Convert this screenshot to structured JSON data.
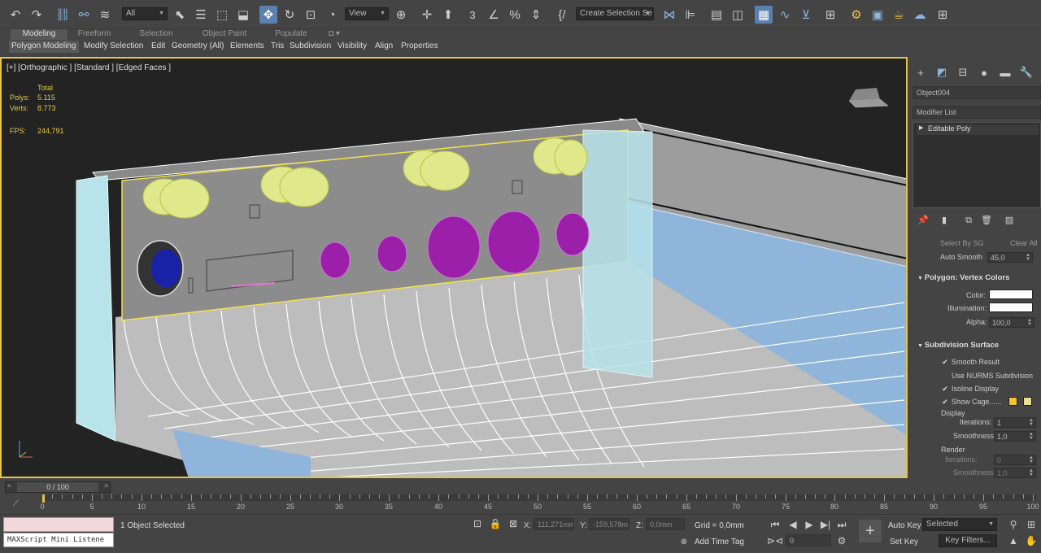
{
  "toolbar": {
    "filter_value": "All",
    "ref_coord_value": "View",
    "named_selection_placeholder": "Create Selection Se",
    "icons": [
      "undo-icon",
      "redo-icon",
      "link-icon",
      "unlink-icon",
      "bind-space-warp-icon",
      "select-object-icon",
      "select-by-name-icon",
      "rect-region-icon",
      "window-crossing-icon",
      "select-move-icon",
      "select-rotate-icon",
      "select-scale-icon",
      "select-place-icon",
      "pivot-icon",
      "keyboard-shortcut-icon",
      "snaps-3d-icon",
      "angle-snap-icon",
      "percent-snap-icon",
      "spinner-snap-icon",
      "edit-named-sel-icon",
      "mirror-icon",
      "align-icon",
      "scene-explorer-icon",
      "layer-explorer-icon",
      "ribbon-icon",
      "curve-editor-icon",
      "schematic-view-icon",
      "material-editor-icon",
      "render-setup-icon",
      "rendered-frame-icon",
      "render-icon",
      "render-cloud-icon",
      "a360-icon",
      "grid-icon"
    ]
  },
  "ribbon": {
    "tabs": [
      "Modeling",
      "Freeform",
      "Selection",
      "Object Paint",
      "Populate"
    ],
    "buttons": [
      "Polygon Modeling",
      "Modify Selection",
      "Edit",
      "Geometry (All)",
      "Elements",
      "Tris",
      "Subdivision",
      "Visibility",
      "Align",
      "Properties"
    ]
  },
  "viewport": {
    "label": "[+] [Orthographic ] [Standard ] [Edged Faces ]",
    "stats": {
      "total_label": "Total",
      "polys_label": "Polys:",
      "polys_value": "5.115",
      "verts_label": "Verts:",
      "verts_value": "8.773",
      "fps_label": "FPS:",
      "fps_value": "244,791"
    }
  },
  "command_panel": {
    "object_name": "Object004",
    "modifier_list_label": "Modifier List",
    "stack_item": "Editable Poly",
    "select_by_sg": "Select By SG",
    "clear_all": "Clear All",
    "auto_smooth_label": "Auto Smooth",
    "auto_smooth_value": "45,0",
    "vertex_colors_title": "Polygon: Vertex Colors",
    "color_label": "Color:",
    "illumination_label": "Illumination:",
    "alpha_label": "Alpha:",
    "alpha_value": "100,0",
    "subdivision_title": "Subdivision Surface",
    "smooth_result": "Smooth Result",
    "use_nurms": "Use NURMS Subdivision",
    "isoline_display": "Isoline Display",
    "show_cage": "Show Cage......",
    "display_label": "Display",
    "iterations_label": "Iterations:",
    "display_iterations": "1",
    "smoothness_label": "Smoothness:",
    "display_smoothness": "1,0",
    "render_label": "Render",
    "render_iterations": "0",
    "render_smoothness": "1,0",
    "checks": {
      "smooth_result": true,
      "use_nurms": false,
      "isoline_display": true,
      "show_cage": true
    },
    "cage_colors": [
      "#f2c230",
      "#e8e090"
    ]
  },
  "time_slider": {
    "frame_label": "0 / 100",
    "ticks": [
      "0",
      "5",
      "10",
      "15",
      "20",
      "25",
      "30",
      "35",
      "40",
      "45",
      "50",
      "55",
      "60",
      "65",
      "70",
      "75",
      "80",
      "85",
      "90",
      "95",
      "100"
    ]
  },
  "status": {
    "maxscript_label": "MAXScript Mini Listene",
    "selection_status": "1 Object Selected",
    "x_label": "X:",
    "x_value": "111,271mm",
    "y_label": "Y:",
    "y_value": "-159,578m",
    "z_label": "Z:",
    "z_value": "0,0mm",
    "grid": "Grid = 0,0mm",
    "add_time_tag": "Add Time Tag",
    "auto_key": "Auto Key",
    "set_key": "Set Key",
    "selected_value": "Selected",
    "key_filters": "Key Filters...",
    "current_frame": "0"
  }
}
